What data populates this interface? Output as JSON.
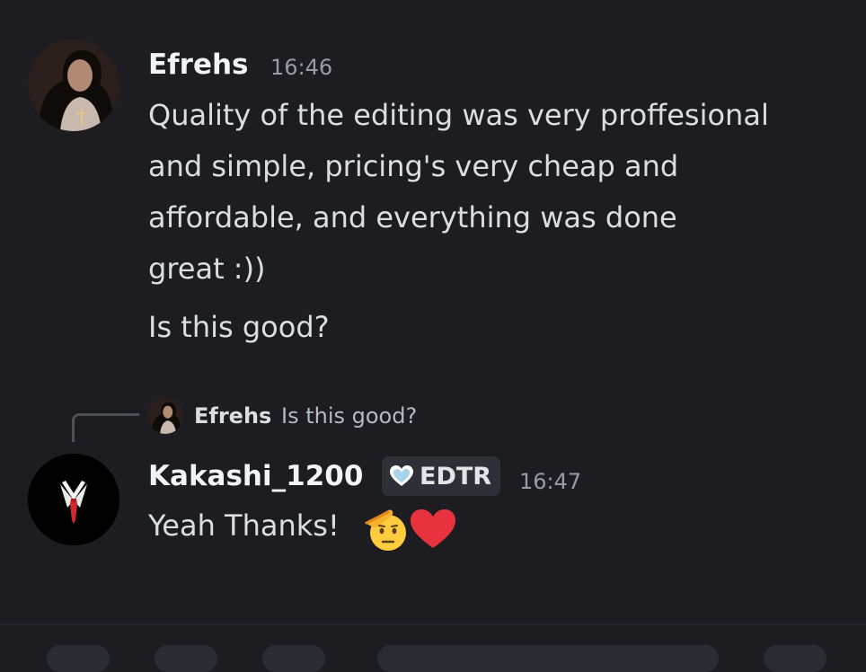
{
  "messages": [
    {
      "author": "Efrehs",
      "time": "16:46",
      "avatar_icon": "user-avatar-photo",
      "lines": [
        "Quality of the editing was very proffesional",
        "and simple, pricing's very cheap and",
        "affordable, and everything was done",
        "great :))"
      ],
      "followup": "Is this good?"
    },
    {
      "reply_to": {
        "author": "Efrehs",
        "text": "Is this good?"
      },
      "author": "Kakashi_1200",
      "badge": {
        "icon": "heart-badge-icon",
        "label": "EDTR"
      },
      "time": "16:47",
      "avatar_icon": "suit-tie-avatar",
      "text": "Yeah Thanks!",
      "emojis": [
        "saluting-face-emoji",
        "red-heart-emoji"
      ]
    }
  ],
  "colors": {
    "background": "#1c1c21",
    "author": "#f2f3f5",
    "text": "#dbdee1",
    "muted": "#9a9ca3",
    "heart": "#e8333e",
    "badge_bg": "#2e3037"
  }
}
